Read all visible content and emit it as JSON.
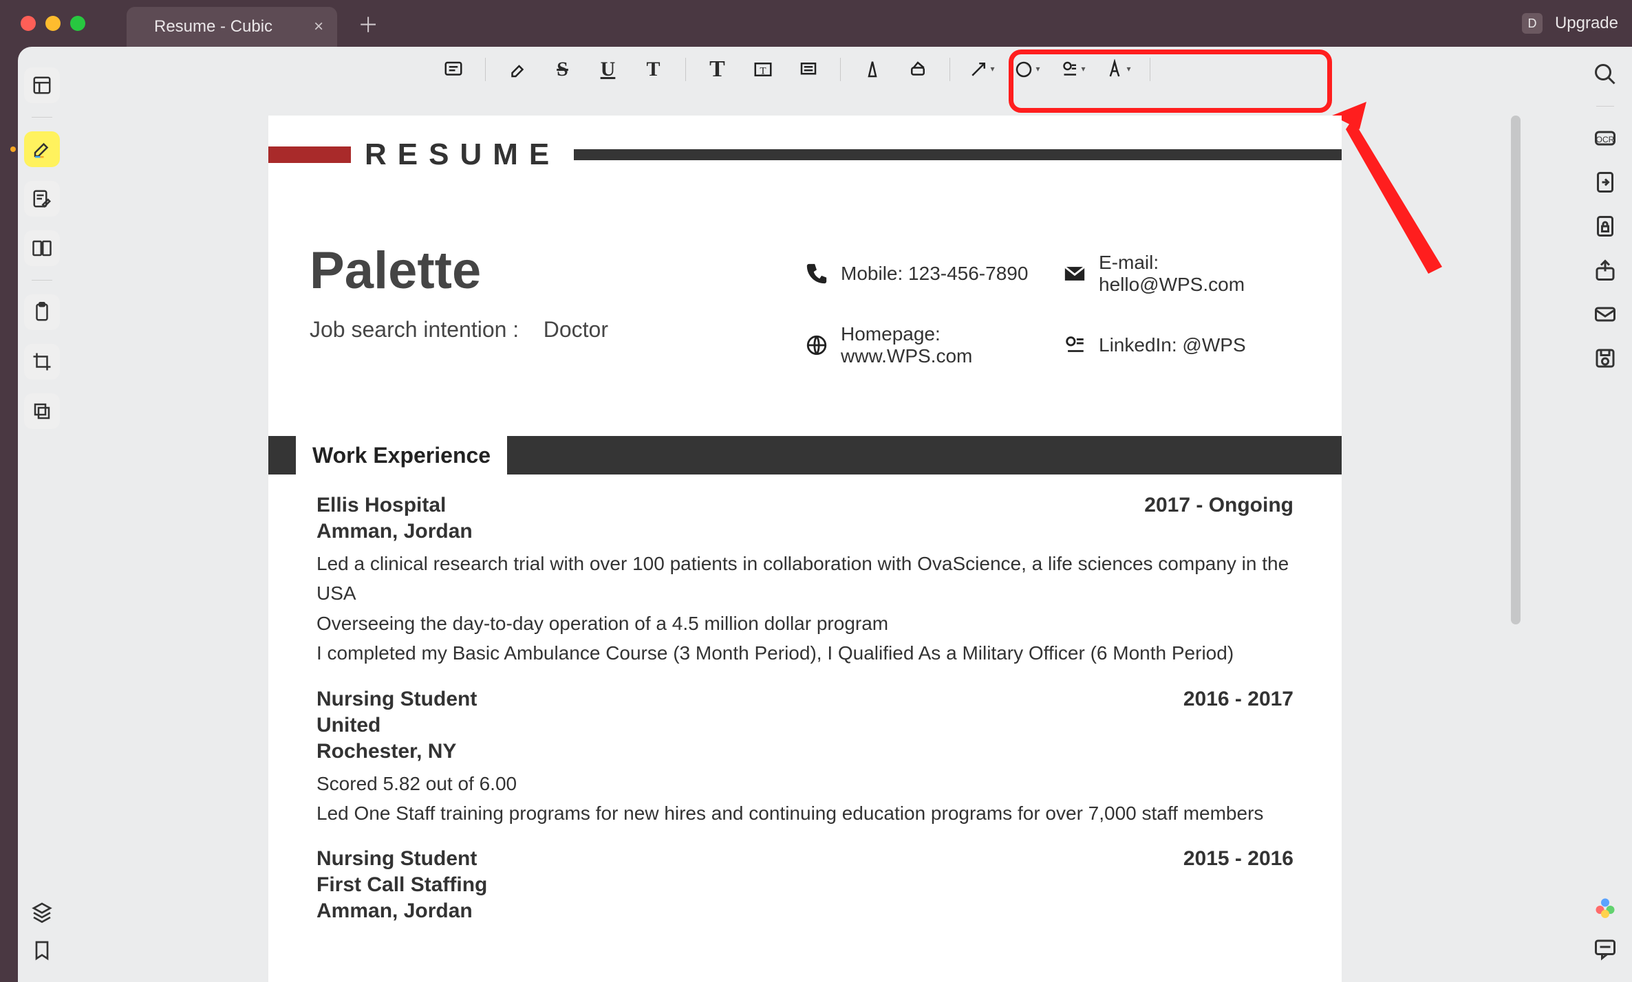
{
  "window": {
    "tab_title": "Resume - Cubic",
    "upgrade_label": "Upgrade",
    "avatar_letter": "D"
  },
  "toolbar": {
    "groups": [
      [
        "note",
        "highlighter",
        "strikethrough",
        "underline",
        "text-t"
      ],
      [
        "text-T",
        "textbox",
        "align"
      ],
      [
        "pencil",
        "marker"
      ],
      [
        "arrow-dd",
        "lasso-dd",
        "stamp-dd",
        "ink-dd"
      ]
    ]
  },
  "left_rail": {
    "items": [
      "thumbnails",
      "highlighter",
      "edit-pen",
      "compare",
      "clipboard",
      "crop",
      "layers-small"
    ]
  },
  "right_rail": {
    "items": [
      "search",
      "ocr",
      "convert",
      "protect",
      "share",
      "mail",
      "save"
    ],
    "bottom": [
      "ai-flower",
      "feedback"
    ]
  },
  "document": {
    "header_word": "RESUME",
    "name": "Palette",
    "intent_label": "Job search intention :",
    "intent_value": "Doctor",
    "contacts": {
      "mobile_label": "Mobile:",
      "mobile_value": "123-456-7890",
      "email_label": "E-mail:",
      "email_value": "hello@WPS.com",
      "homepage_label": "Homepage:",
      "homepage_value": "www.WPS.com",
      "linkedin_label": "LinkedIn:",
      "linkedin_value": "@WPS"
    },
    "section_title": "Work Experience",
    "experiences": [
      {
        "title": "Ellis Hospital",
        "sub1": "Amman,  Jordan",
        "period": "2017 - Ongoing",
        "lines": [
          "Led a  clinical research trial with over 100 patients in collaboration with OvaScience, a life sciences company in the USA",
          "Overseeing the day-to-day operation of a 4.5 million dollar program",
          "I completed my Basic Ambulance Course (3 Month Period), I Qualified As a Military Officer (6 Month Period)"
        ]
      },
      {
        "title": "Nursing Student",
        "sub1": "United",
        "sub2": "Rochester, NY",
        "period": "2016 - 2017",
        "lines": [
          "Scored 5.82 out of 6.00",
          "Led  One  Staff  training  programs  for  new hires and continuing education programs for over 7,000 staff members"
        ]
      },
      {
        "title": "Nursing Student",
        "sub1": "First Call Staffing",
        "sub2": "Amman,  Jordan",
        "period": "2015 - 2016",
        "lines": []
      }
    ]
  }
}
